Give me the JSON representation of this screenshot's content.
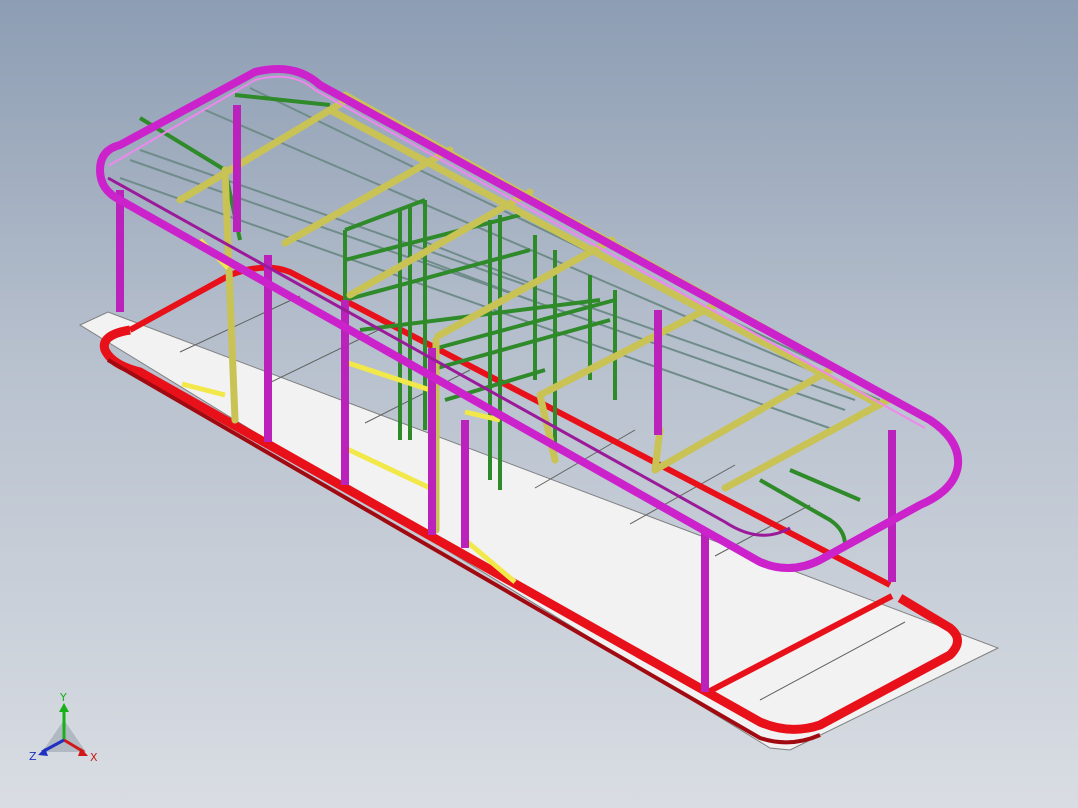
{
  "viewport": {
    "background_top": "#8d9db3",
    "background_bottom": "#d9dde3"
  },
  "model": {
    "parts": [
      {
        "name": "floor-panel",
        "color": "#f0f0f0"
      },
      {
        "name": "base-frame",
        "color": "#e8111a"
      },
      {
        "name": "roof-frame",
        "color": "#cc22cc"
      },
      {
        "name": "roof-crossbeams",
        "color": "#d6d05a"
      },
      {
        "name": "inner-frame",
        "color": "#2f8a2a"
      },
      {
        "name": "gray-rails",
        "color": "#6f8c8a"
      },
      {
        "name": "yellow-braces",
        "color": "#f2e84a"
      }
    ]
  },
  "triad": {
    "x_label": "X",
    "y_label": "Y",
    "z_label": "Z",
    "x_color": "#d01818",
    "y_color": "#18b018",
    "z_color": "#2030c0"
  }
}
